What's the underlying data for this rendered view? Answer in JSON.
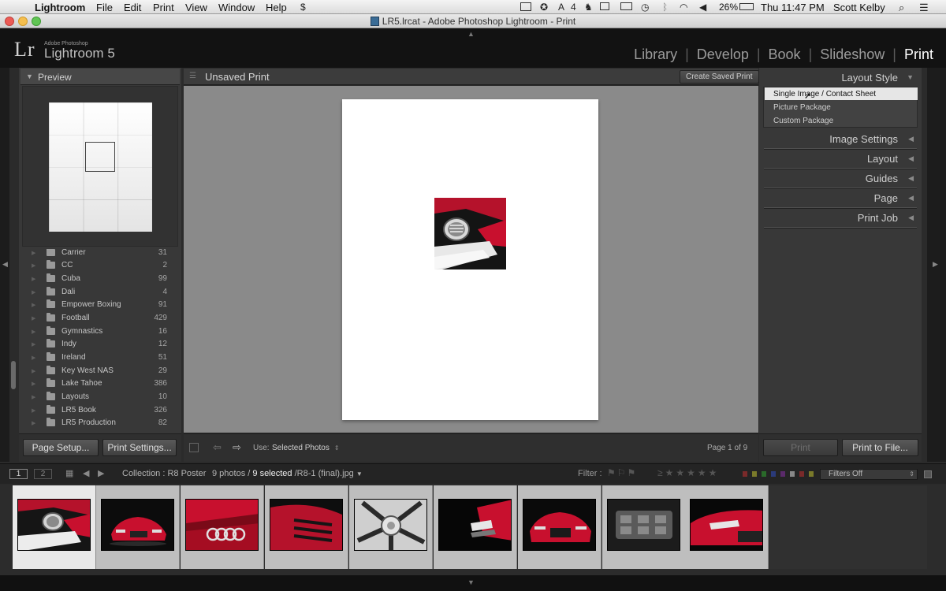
{
  "menubar": {
    "items": [
      "Lightroom",
      "File",
      "Edit",
      "Print",
      "View",
      "Window",
      "Help"
    ],
    "status_num": "4",
    "battery": "26%",
    "clock": "Thu 11:47 PM",
    "user": "Scott Kelby"
  },
  "window": {
    "title": "LR5.lrcat - Adobe Photoshop Lightroom - Print"
  },
  "identity": {
    "logo": "Lr",
    "sub": "Adobe Photoshop",
    "name": "Lightroom 5"
  },
  "modules": [
    "Library",
    "Develop",
    "Book",
    "Slideshow",
    "Print"
  ],
  "left_panel": {
    "preview_title": "Preview",
    "folders": [
      {
        "name": "Carrier",
        "count": "31"
      },
      {
        "name": "CC",
        "count": "2"
      },
      {
        "name": "Cuba",
        "count": "99"
      },
      {
        "name": "Dali",
        "count": "4"
      },
      {
        "name": "Empower Boxing",
        "count": "91"
      },
      {
        "name": "Football",
        "count": "429"
      },
      {
        "name": "Gymnastics",
        "count": "16"
      },
      {
        "name": "Indy",
        "count": "12"
      },
      {
        "name": "Ireland",
        "count": "51"
      },
      {
        "name": "Key West NAS",
        "count": "29"
      },
      {
        "name": "Lake Tahoe",
        "count": "386"
      },
      {
        "name": "Layouts",
        "count": "10"
      },
      {
        "name": "LR5 Book",
        "count": "326"
      },
      {
        "name": "LR5 Production",
        "count": "82"
      }
    ],
    "page_setup": "Page Setup...",
    "print_settings": "Print Settings..."
  },
  "center": {
    "title": "Unsaved Print",
    "create_saved": "Create Saved Print",
    "use_label": "Use:",
    "use_value": "Selected Photos",
    "page_indicator": "Page 1 of 9"
  },
  "right_panel": {
    "layout_style": "Layout Style",
    "styles": [
      "Single Image / Contact Sheet",
      "Picture Package",
      "Custom Package"
    ],
    "sections": [
      "Image Settings",
      "Layout",
      "Guides",
      "Page",
      "Print Job"
    ],
    "print": "Print",
    "print_to_file": "Print to File..."
  },
  "filmstrip": {
    "view1": "1",
    "view2": "2",
    "collection": "Collection : R8 Poster",
    "count_prefix": "9 photos /",
    "selected": "9 selected",
    "filename": "/R8-1 (final).jpg",
    "filter_label": "Filter :",
    "filters_off": "Filters Off",
    "thumbnails": [
      "chrome",
      "car-front",
      "rings",
      "vents",
      "wheel",
      "headlight",
      "car-front-2",
      "engine",
      "car-side"
    ]
  },
  "colors": {
    "accent_red": "#c8102e",
    "panel": "#383838",
    "canvas": "#8a8a8a"
  }
}
